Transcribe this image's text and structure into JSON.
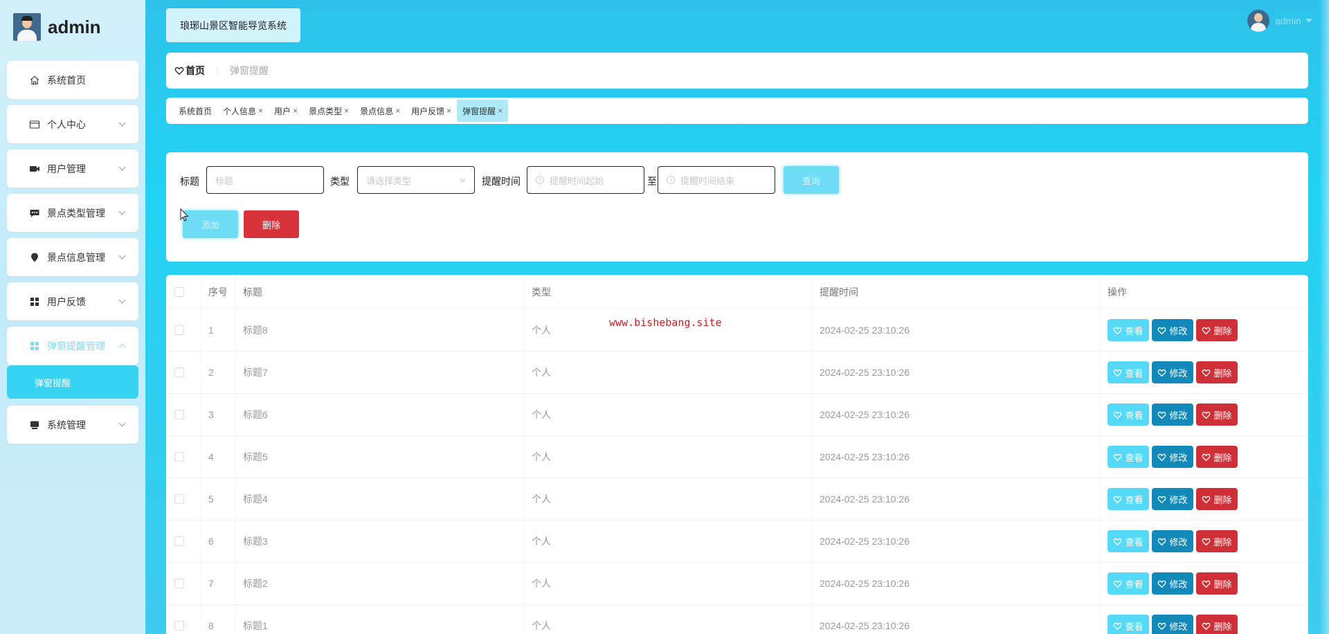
{
  "brand": {
    "name": "admin"
  },
  "sidebar": {
    "items": [
      {
        "label": "系统首页",
        "icon": "home-icon"
      },
      {
        "label": "个人中心",
        "icon": "id-card-icon"
      },
      {
        "label": "用户管理",
        "icon": "video-camera-icon"
      },
      {
        "label": "景点类型管理",
        "icon": "chat-bubble-icon"
      },
      {
        "label": "景点信息管理",
        "icon": "location-pin-icon"
      },
      {
        "label": "用户反馈",
        "icon": "grid-icon"
      },
      {
        "label": "弹窗提醒管理",
        "icon": "grid-icon"
      },
      {
        "label": "系统管理",
        "icon": "monitor-icon"
      }
    ],
    "submenu_active": "弹窗提醒"
  },
  "header": {
    "system_title": "琅琊山景区智能导览系统",
    "user_name": "admin"
  },
  "breadcrumb": {
    "home": "首页",
    "current": "弹窗提醒"
  },
  "tags": [
    {
      "label": "系统首页"
    },
    {
      "label": "个人信息"
    },
    {
      "label": "用户"
    },
    {
      "label": "景点类型"
    },
    {
      "label": "景点信息"
    },
    {
      "label": "用户反馈"
    },
    {
      "label": "弹窗提醒"
    }
  ],
  "search": {
    "title_label": "标题",
    "title_placeholder": "标题",
    "type_label": "类型",
    "type_placeholder": "请选择类型",
    "time_label": "提醒时间",
    "time_start_placeholder": "提醒时间起始",
    "to_label": "至",
    "time_end_placeholder": "提醒时间结束",
    "query_button": "查询",
    "add_button": "添加",
    "delete_button": "删除"
  },
  "table": {
    "headers": {
      "index": "序号",
      "title": "标题",
      "type": "类型",
      "time": "提醒时间",
      "actions": "操作"
    },
    "actions": {
      "view": "查看",
      "edit": "修改",
      "delete": "删除"
    },
    "rows": [
      {
        "index": "1",
        "title": "标题8",
        "type": "个人",
        "time": "2024-02-25 23:10:26"
      },
      {
        "index": "2",
        "title": "标题7",
        "type": "个人",
        "time": "2024-02-25 23:10:26"
      },
      {
        "index": "3",
        "title": "标题6",
        "type": "个人",
        "time": "2024-02-25 23:10:26"
      },
      {
        "index": "4",
        "title": "标题5",
        "type": "个人",
        "time": "2024-02-25 23:10:26"
      },
      {
        "index": "5",
        "title": "标题4",
        "type": "个人",
        "time": "2024-02-25 23:10:26"
      },
      {
        "index": "6",
        "title": "标题3",
        "type": "个人",
        "time": "2024-02-25 23:10:26"
      },
      {
        "index": "7",
        "title": "标题2",
        "type": "个人",
        "time": "2024-02-25 23:10:26"
      },
      {
        "index": "8",
        "title": "标题1",
        "type": "个人",
        "time": "2024-02-25 23:10:26"
      }
    ]
  },
  "watermark": "www.bishebang.site",
  "colors": {
    "accent": "#38d3f3",
    "edit": "#1289b8",
    "danger": "#cf2f36"
  }
}
